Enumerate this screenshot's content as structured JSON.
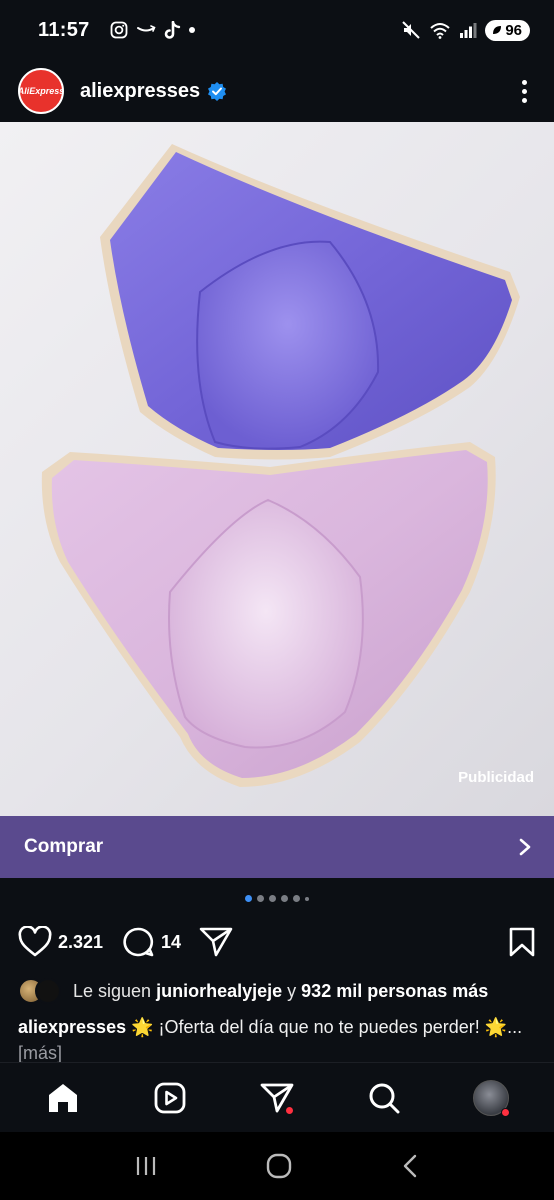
{
  "status_bar": {
    "time": "11:57",
    "battery": "96"
  },
  "post": {
    "account_name": "aliexpresses",
    "avatar_text": "AliExpress",
    "ad_label": "Publicidad",
    "cta_label": "Comprar",
    "carousel": {
      "count": 6,
      "active_index": 0
    },
    "likes": "2.321",
    "comments": "14",
    "followed_by": {
      "prefix": "Le siguen",
      "user": "juniorhealyjeje",
      "middle": "y",
      "rest": "932 mil personas más"
    },
    "caption": {
      "account": "aliexpresses",
      "text": "🌟 ¡Oferta del día que no te puedes perder! 🌟...",
      "more": "[más]"
    }
  },
  "colors": {
    "background": "#0c0f14",
    "cta": "#5a4a8e",
    "brand_red": "#e8322c",
    "verified_blue": "#1f8ef1",
    "notification_red": "#ff3040"
  },
  "icons": {
    "status": [
      "instagram-icon",
      "amazon-icon",
      "tiktok-icon",
      "mute-icon",
      "wifi-icon",
      "signal-icon"
    ],
    "actions": [
      "heart-icon",
      "comment-icon",
      "share-icon",
      "bookmark-icon"
    ],
    "nav": [
      "home-icon",
      "reels-icon",
      "send-icon",
      "search-icon",
      "profile-avatar"
    ]
  }
}
